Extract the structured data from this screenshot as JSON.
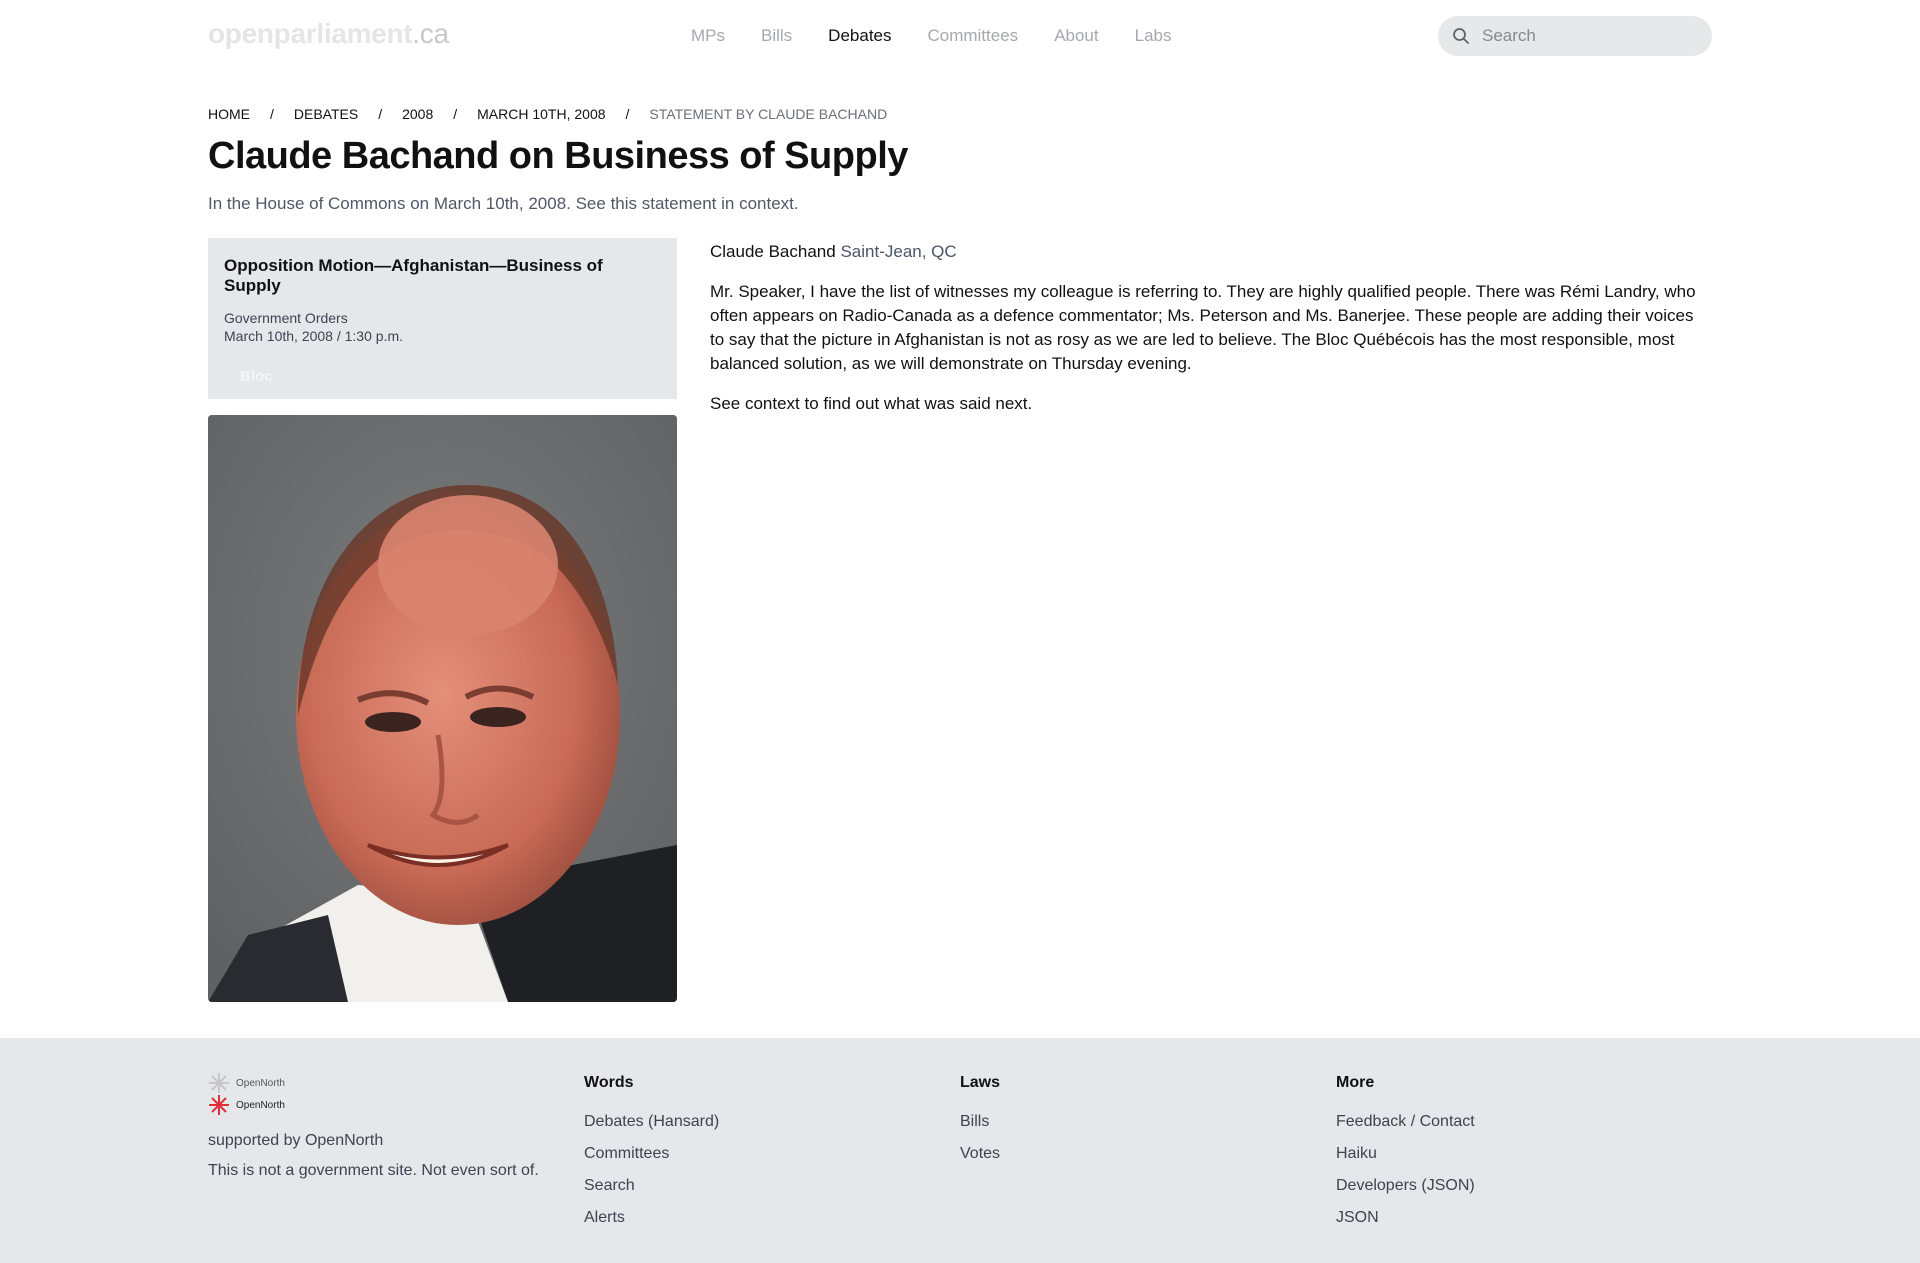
{
  "header": {
    "logo_main": "openparliament",
    "logo_tld": ".ca",
    "nav": [
      "MPs",
      "Bills",
      "Debates",
      "Committees",
      "About",
      "Labs"
    ],
    "active_nav": "Debates",
    "search_placeholder": "Search"
  },
  "breadcrumb": {
    "items": [
      "HOME",
      "DEBATES",
      "2008",
      "MARCH 10TH, 2008"
    ],
    "separator": "/",
    "current": "STATEMENT BY CLAUDE BACHAND"
  },
  "page": {
    "title": "Claude Bachand on Business of Supply",
    "subtitle": "In the House of Commons on March 10th, 2008. See this statement in context."
  },
  "infobox": {
    "topic": "Opposition Motion—Afghanistan—Business of Supply",
    "orders": "Government Orders",
    "date": "March 10th, 2008 / 1:30 p.m.",
    "party": "Bloc"
  },
  "statement": {
    "speaker": "Claude Bachand",
    "riding": "Saint-Jean, QC",
    "text": "Mr. Speaker, I have the list of witnesses my colleague is referring to. They are highly qualified people. There was Rémi Landry, who often appears on Radio-Canada as a defence commentator; Ms. Peterson and Ms. Banerjee. These people are adding their voices to say that the picture in Afghanistan is not as rosy as we are led to believe. The Bloc Québécois has the most responsible, most balanced solution, as we will demonstrate on Thursday evening.",
    "context": "See context to find out what was said next."
  },
  "footer": {
    "brand_logo": "OpenNorth",
    "supported": "supported by OpenNorth",
    "disclaimer": "This is not a government site. Not even sort of.",
    "cols": [
      {
        "heading": "Words",
        "links": [
          "Debates (Hansard)",
          "Committees",
          "Search",
          "Alerts"
        ]
      },
      {
        "heading": "Laws",
        "links": [
          "Bills",
          "Votes"
        ]
      },
      {
        "heading": "More",
        "links": [
          "Feedback / Contact",
          "Haiku",
          "Developers (JSON)",
          "JSON"
        ]
      }
    ]
  },
  "colors": {
    "background": "#ffffff",
    "panel": "#e5e7eb",
    "muted_text": "#a6a8ad",
    "accent_text": "#4a5568"
  }
}
